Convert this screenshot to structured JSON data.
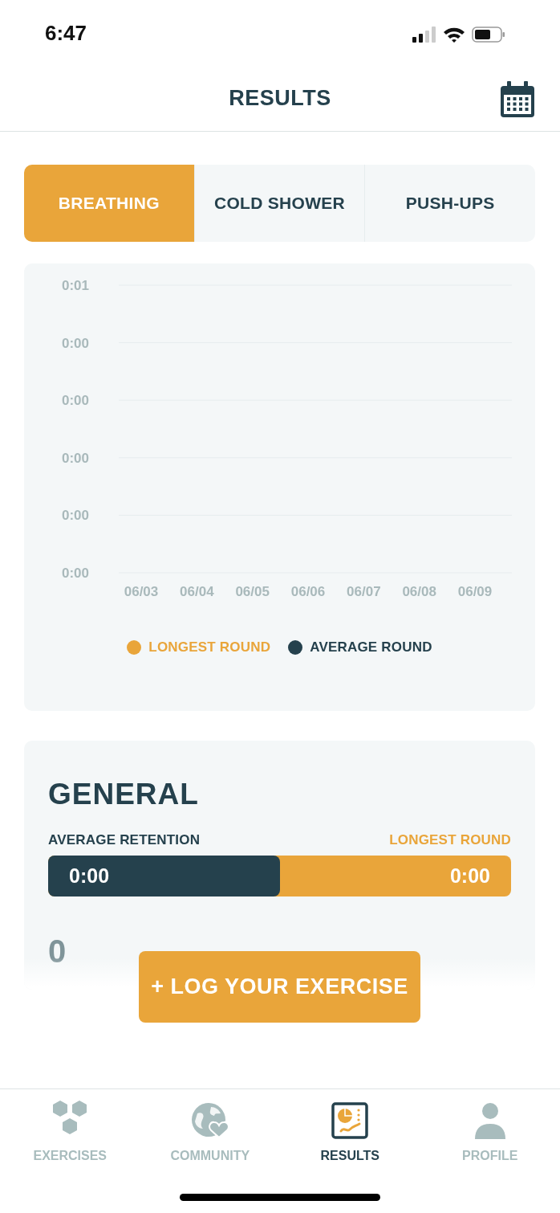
{
  "status_bar": {
    "time": "6:47"
  },
  "header": {
    "title": "RESULTS"
  },
  "tabs": [
    {
      "label": "BREATHING",
      "selected": true
    },
    {
      "label": "COLD SHOWER",
      "selected": false
    },
    {
      "label": "PUSH-UPS",
      "selected": false
    }
  ],
  "chart": {
    "chart_data": {
      "type": "line",
      "categories": [
        "06/03",
        "06/04",
        "06/05",
        "06/06",
        "06/07",
        "06/08",
        "06/09"
      ],
      "series": [
        {
          "name": "LONGEST ROUND",
          "color": "#e9a53a",
          "values": [
            null,
            null,
            null,
            null,
            null,
            null,
            null
          ]
        },
        {
          "name": "AVERAGE ROUND",
          "color": "#25414d",
          "values": [
            null,
            null,
            null,
            null,
            null,
            null,
            null
          ]
        }
      ],
      "ylim": [
        0,
        1
      ],
      "grid": true,
      "yticks": [
        {
          "value": 1,
          "label": "0:01"
        },
        {
          "value": 0.8,
          "label": "0:00"
        },
        {
          "value": 0.6,
          "label": "0:00"
        },
        {
          "value": 0.4,
          "label": "0:00"
        },
        {
          "value": 0.2,
          "label": "0:00"
        },
        {
          "value": 0,
          "label": "0:00"
        }
      ]
    }
  },
  "general": {
    "title": "GENERAL",
    "left_label": "AVERAGE RETENTION",
    "right_label": "LONGEST ROUND",
    "left_value": "0:00",
    "right_value": "0:00",
    "level": 0.5,
    "stats": [
      {
        "value": "0"
      }
    ]
  },
  "log_button": {
    "label": "+ LOG YOUR EXERCISE"
  },
  "bottom_nav": [
    {
      "label": "EXERCISES",
      "kind": "hexagons",
      "selected": false
    },
    {
      "label": "COMMUNITY",
      "kind": "globe",
      "selected": false
    },
    {
      "label": "RESULTS",
      "kind": "results",
      "selected": true
    },
    {
      "label": "PROFILE",
      "kind": "person",
      "selected": false
    }
  ]
}
